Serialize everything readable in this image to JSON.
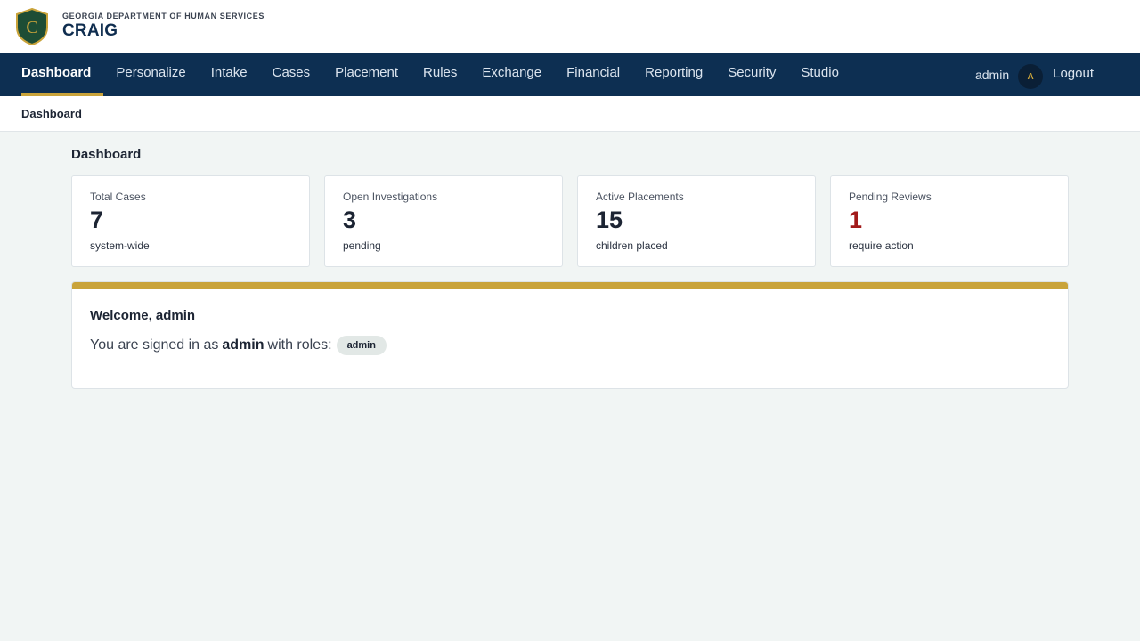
{
  "header": {
    "agency": "GEORGIA DEPARTMENT OF HUMAN SERVICES",
    "app_title": "CRAIG",
    "logo_letter": "C",
    "logo_colors": {
      "shield": "#1d4d35",
      "border": "#c9a33a",
      "letter": "#c9a33a"
    }
  },
  "nav": {
    "items": [
      {
        "label": "Dashboard",
        "active": true
      },
      {
        "label": "Personalize",
        "active": false
      },
      {
        "label": "Intake",
        "active": false
      },
      {
        "label": "Cases",
        "active": false
      },
      {
        "label": "Placement",
        "active": false
      },
      {
        "label": "Rules",
        "active": false
      },
      {
        "label": "Exchange",
        "active": false
      },
      {
        "label": "Financial",
        "active": false
      },
      {
        "label": "Reporting",
        "active": false
      },
      {
        "label": "Security",
        "active": false
      },
      {
        "label": "Studio",
        "active": false
      }
    ],
    "user": "admin",
    "avatar_initial": "A",
    "logout_label": "Logout"
  },
  "breadcrumb": "Dashboard",
  "page_title": "Dashboard",
  "stats": [
    {
      "label": "Total Cases",
      "value": "7",
      "sub": "system-wide"
    },
    {
      "label": "Open Investigations",
      "value": "3",
      "sub": "pending"
    },
    {
      "label": "Active Placements",
      "value": "15",
      "sub": "children placed"
    },
    {
      "label": "Pending Reviews",
      "value": "1",
      "sub": "require action"
    }
  ],
  "welcome": {
    "title": "Welcome, admin",
    "text_before": "You are signed in as",
    "username": "admin",
    "text_after": "with roles:",
    "roles": [
      "admin"
    ]
  },
  "colors": {
    "nav_bg": "#0d2f52",
    "accent_gold": "#c9a33a",
    "alert_red": "#a21a1a",
    "page_bg": "#f1f5f4"
  }
}
